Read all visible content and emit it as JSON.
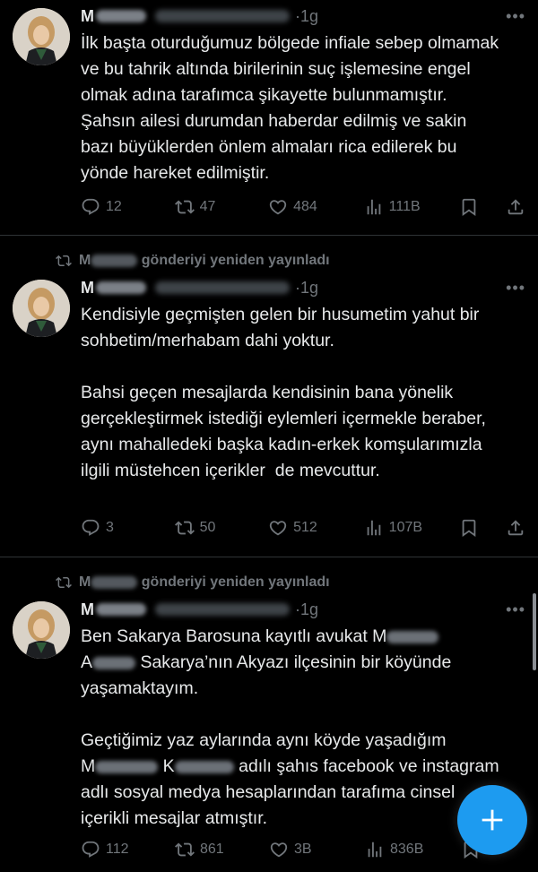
{
  "tweets": [
    {
      "reposted_by_label": "",
      "time": "1g",
      "text": "İlk başta oturduğumuz bölgede infiale sebep olmamak ve bu tahrik altında birilerinin suç işlemesine engel olmak adına tarafımca şikayette bulunmamıştır. Şahsın ailesi durumdan haberdar edilmiş ve sakin bazı büyüklerden önlem almaları rica edilerek bu yönde hareket edilmiştir.",
      "stats": {
        "replies": "12",
        "reposts": "47",
        "likes": "484",
        "views": "111B"
      }
    },
    {
      "reposted_by_label": "gönderiyi yeniden yayınladı",
      "time": "1g",
      "text": "Kendisiyle geçmişten gelen bir husumetim yahut bir sohbetim/merhabam dahi yoktur.\n\nBahsi geçen mesajlarda kendisinin bana yönelik gerçekleştirmek istediği eylemleri içermekle beraber, aynı mahalledeki başka kadın-erkek komşularımızla ilgili müstehcen içerikler  de mevcuttur.",
      "stats": {
        "replies": "3",
        "reposts": "50",
        "likes": "512",
        "views": "107B"
      }
    },
    {
      "reposted_by_label": "gönderiyi yeniden yayınladı",
      "time": "1g",
      "text_line1": "Ben Sakarya Barosuna kayıtlı avukat M",
      "text_line2": "Sakarya’nın Akyazı ilçesinin bir köyünde yaşamaktayım.",
      "text_para2a": "Geçtiğimiz yaz aylarında aynı köyde yaşadığım",
      "text_para2b": "adılı şahıs facebook ve instagram adlı sosyal medya hesaplarından tarafıma cinsel içerikli mesajlar atmıştır.",
      "stats": {
        "replies": "112",
        "reposts": "861",
        "likes": "3B",
        "views": "836B"
      }
    }
  ],
  "name_initial": "M",
  "name_initial_2": "A",
  "name_initial_3": "K",
  "more_icon": "•••",
  "fab_icon": "plus-icon",
  "colors": {
    "accent": "#1d9bf0",
    "muted": "#71767b",
    "text": "#e7e9ea",
    "bg": "#000000"
  }
}
